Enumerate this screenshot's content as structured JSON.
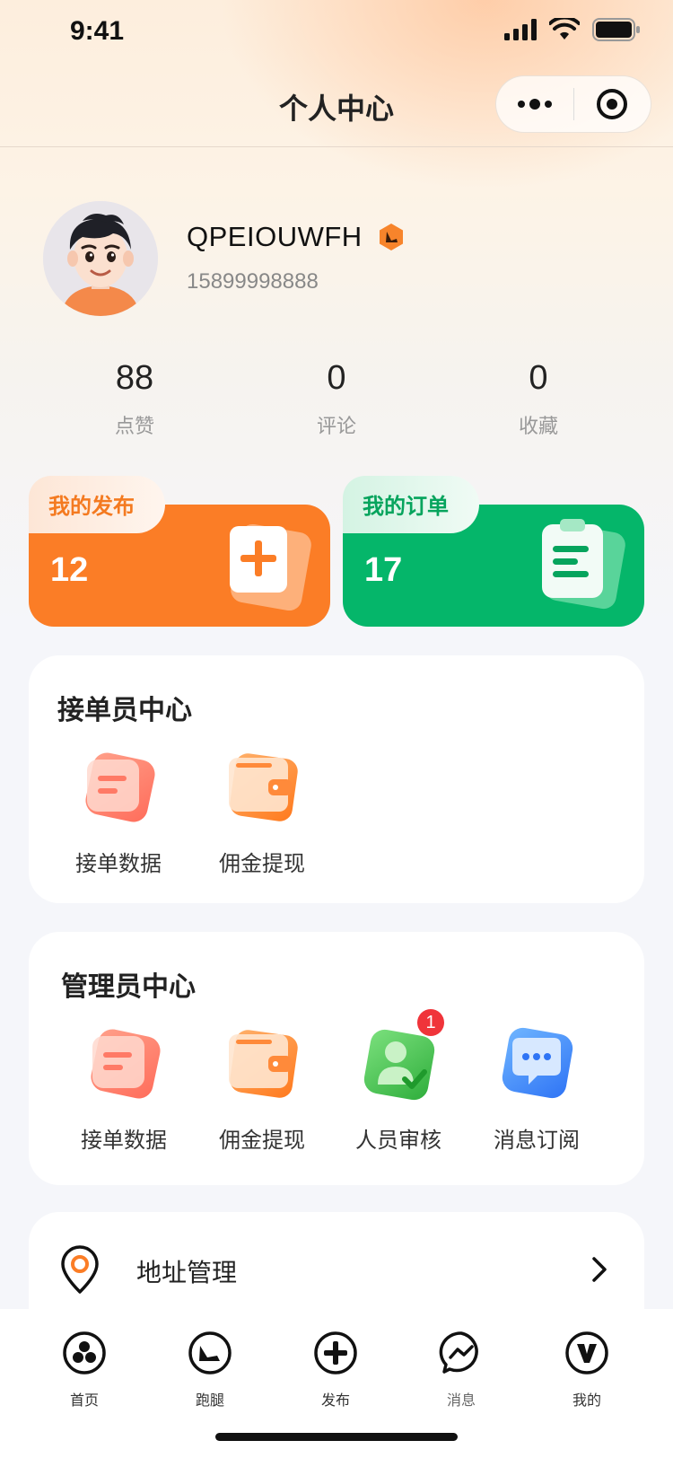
{
  "status_bar": {
    "time": "9:41"
  },
  "nav": {
    "title": "个人中心"
  },
  "profile": {
    "username": "QPEIOUWFH",
    "phone": "15899998888"
  },
  "stats": [
    {
      "value": "88",
      "label": "点赞"
    },
    {
      "value": "0",
      "label": "评论"
    },
    {
      "value": "0",
      "label": "收藏"
    }
  ],
  "cards": {
    "publish": {
      "label": "我的发布",
      "count": "12"
    },
    "orders": {
      "label": "我的订单",
      "count": "17"
    }
  },
  "runner_center": {
    "title": "接单员中心",
    "items": [
      {
        "label": "接单数据",
        "icon": "document-icon"
      },
      {
        "label": "佣金提现",
        "icon": "wallet-icon"
      }
    ]
  },
  "admin_center": {
    "title": "管理员中心",
    "items": [
      {
        "label": "接单数据",
        "icon": "document-icon"
      },
      {
        "label": "佣金提现",
        "icon": "wallet-icon"
      },
      {
        "label": "人员审核",
        "icon": "person-check-icon",
        "badge": "1"
      },
      {
        "label": "消息订阅",
        "icon": "chat-bubble-icon"
      }
    ]
  },
  "address": {
    "label": "地址管理"
  },
  "tabbar": [
    {
      "label": "首页",
      "icon": "home-icon"
    },
    {
      "label": "跑腿",
      "icon": "shoe-icon"
    },
    {
      "label": "发布",
      "icon": "plus-circle-icon"
    },
    {
      "label": "消息",
      "icon": "messenger-icon"
    },
    {
      "label": "我的",
      "icon": "profile-v-icon"
    }
  ],
  "colors": {
    "orange": "#fb7d26",
    "green": "#05b66a",
    "badge_red": "#f0343a"
  }
}
